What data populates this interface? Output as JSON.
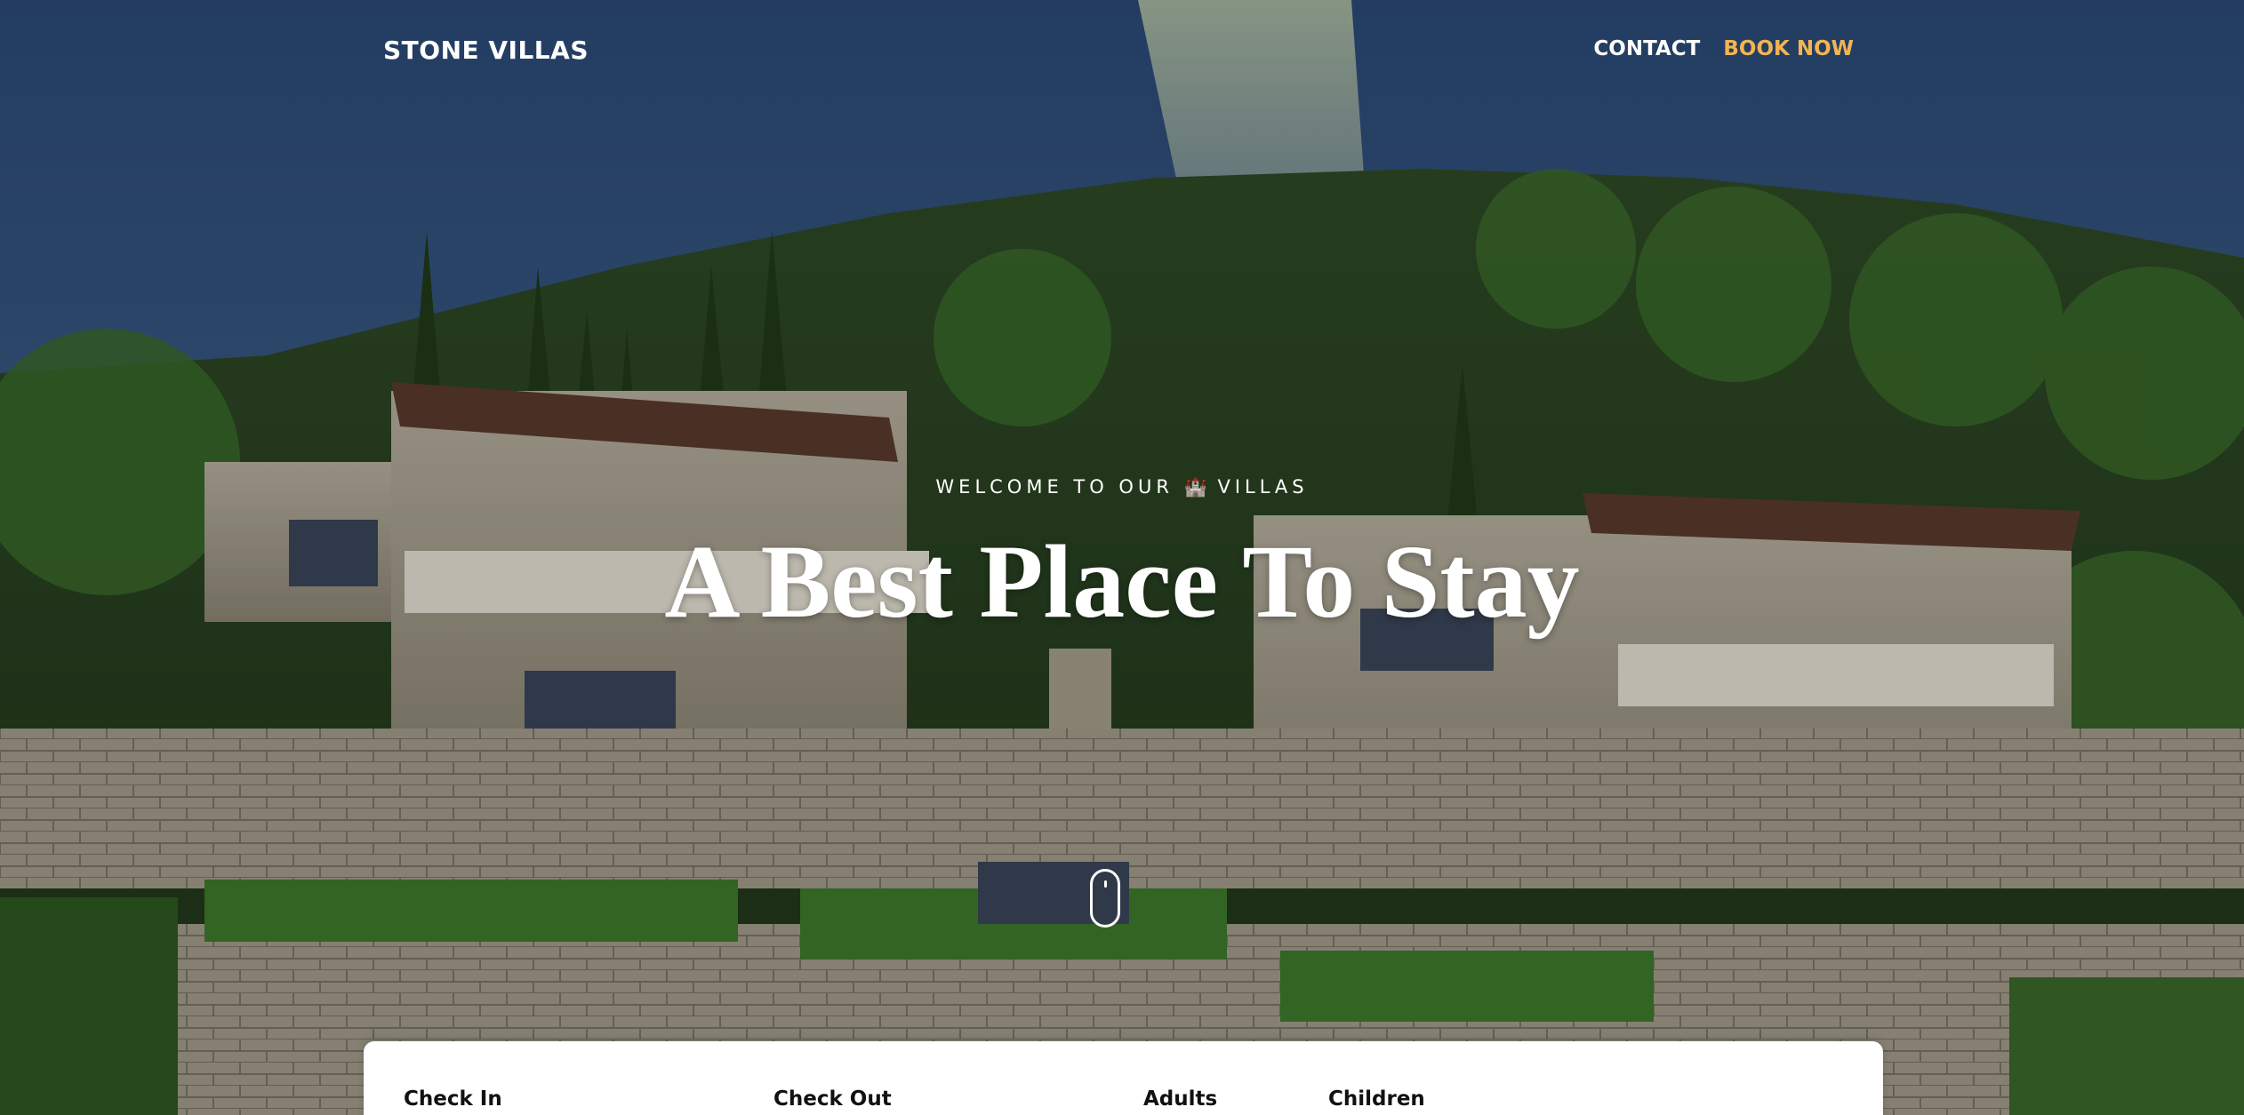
{
  "navbar": {
    "brand": "STONE VILLAS",
    "links": [
      {
        "label": "CONTACT"
      },
      {
        "label": "BOOK NOW"
      }
    ]
  },
  "hero": {
    "welcome_prefix": "WELCOME TO OUR",
    "welcome_emoji": "🏰",
    "welcome_suffix": "VILLAS",
    "headline": "A Best Place To Stay"
  },
  "booking": {
    "fields": [
      {
        "label": "Check In"
      },
      {
        "label": "Check Out"
      },
      {
        "label": "Adults"
      },
      {
        "label": "Children"
      }
    ]
  },
  "colors": {
    "accent": "#f4b451",
    "text_light": "#ffffff",
    "card_bg": "#ffffff"
  },
  "icons": {
    "scroll": "scroll-mouse-icon"
  }
}
